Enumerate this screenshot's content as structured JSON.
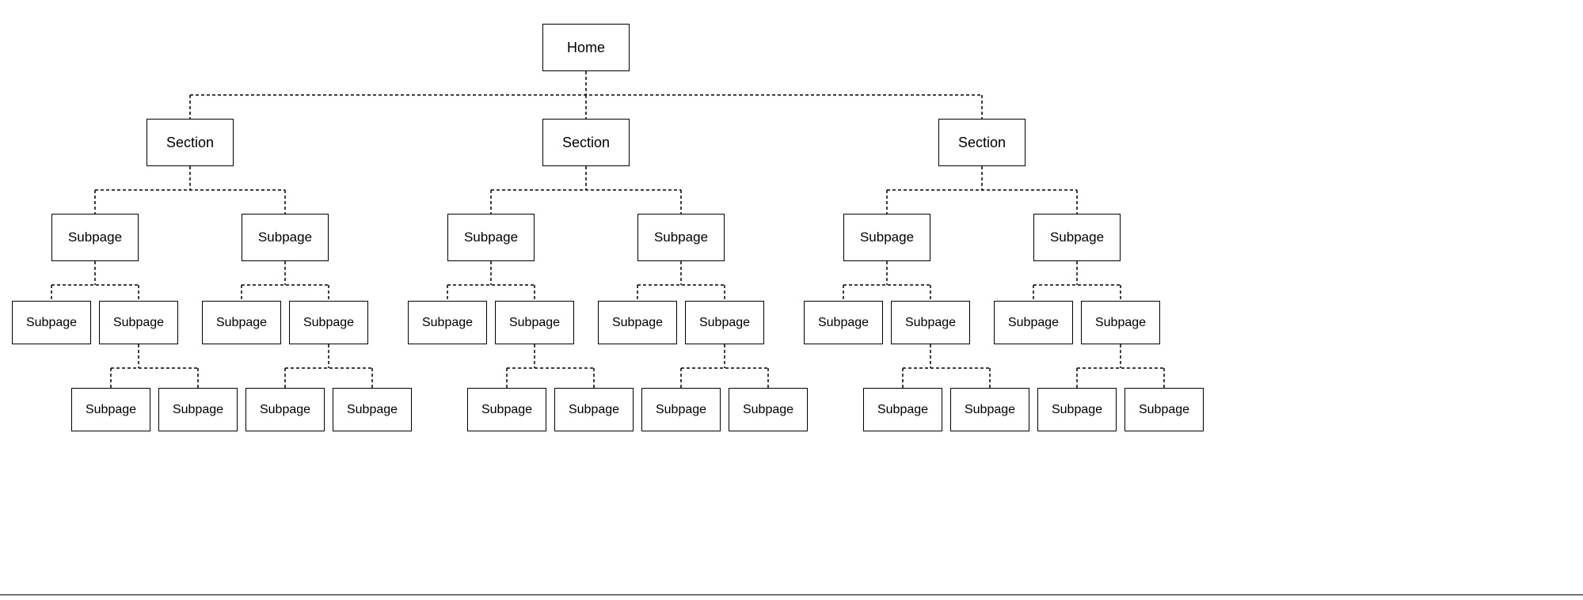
{
  "tree": {
    "root": {
      "label": "Home"
    },
    "sections": [
      {
        "label": "Section",
        "children": [
          {
            "label": "Subpage",
            "children": [
              {
                "label": "Subpage"
              },
              {
                "label": "Subpage",
                "children": [
                  {
                    "label": "Subpage"
                  },
                  {
                    "label": "Subpage"
                  }
                ]
              }
            ]
          },
          {
            "label": "Subpage",
            "children": [
              {
                "label": "Subpage"
              },
              {
                "label": "Subpage",
                "children": [
                  {
                    "label": "Subpage"
                  },
                  {
                    "label": "Subpage"
                  }
                ]
              }
            ]
          }
        ]
      },
      {
        "label": "Section",
        "children": [
          {
            "label": "Subpage",
            "children": [
              {
                "label": "Subpage"
              },
              {
                "label": "Subpage",
                "children": [
                  {
                    "label": "Subpage"
                  },
                  {
                    "label": "Subpage"
                  }
                ]
              }
            ]
          },
          {
            "label": "Subpage",
            "children": [
              {
                "label": "Subpage"
              },
              {
                "label": "Subpage",
                "children": [
                  {
                    "label": "Subpage"
                  },
                  {
                    "label": "Subpage"
                  }
                ]
              }
            ]
          }
        ]
      },
      {
        "label": "Section",
        "children": [
          {
            "label": "Subpage",
            "children": [
              {
                "label": "Subpage"
              },
              {
                "label": "Subpage",
                "children": [
                  {
                    "label": "Subpage"
                  },
                  {
                    "label": "Subpage"
                  }
                ]
              }
            ]
          },
          {
            "label": "Subpage",
            "children": [
              {
                "label": "Subpage"
              },
              {
                "label": "Subpage",
                "children": [
                  {
                    "label": "Subpage"
                  },
                  {
                    "label": "Subpage"
                  }
                ]
              }
            ]
          }
        ]
      }
    ]
  },
  "style": {
    "line_color": "#000000",
    "line_style": "dashed",
    "node_border_color": "#000000",
    "background": "#ffffff"
  }
}
